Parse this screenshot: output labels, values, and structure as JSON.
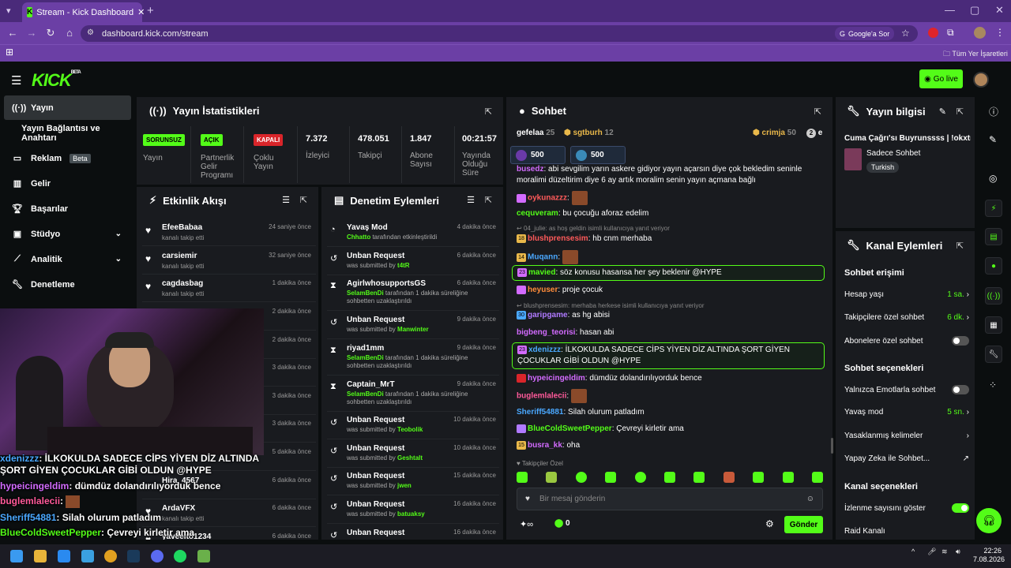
{
  "browser": {
    "tab_title": "Stream - Kick Dashboard",
    "url": "dashboard.kick.com/stream",
    "google_btn": "Google'a Sor",
    "bookmarks_label": "Tüm Yer İşaretleri"
  },
  "header": {
    "logo": "KICK",
    "logo_beta": "BETA",
    "go_live": "Go live"
  },
  "sidebar": {
    "items": [
      {
        "label": "Yayın"
      },
      {
        "label": "Yayın Bağlantısı ve Anahtarı"
      },
      {
        "label": "Reklam",
        "badge": "Beta"
      },
      {
        "label": "Gelir"
      },
      {
        "label": "Başarılar"
      },
      {
        "label": "Stüdyo"
      },
      {
        "label": "Analitik"
      },
      {
        "label": "Denetleme"
      }
    ]
  },
  "stats": {
    "title": "Yayın İstatistikleri",
    "cells": [
      {
        "badge": "SORUNSUZ",
        "label": "Yayın"
      },
      {
        "badge": "AÇIK",
        "label": "Partnerlik Gelir Programı"
      },
      {
        "badge": "KAPALI",
        "label": "Çoklu Yayın"
      },
      {
        "value": "7.372",
        "label": "İzleyici"
      },
      {
        "value": "478.051",
        "label": "Takipçi"
      },
      {
        "value": "1.847",
        "label": "Abone Sayısı"
      },
      {
        "value": "00:21:57",
        "label": "Yayında Olduğu Süre"
      }
    ]
  },
  "feed": {
    "title": "Etkinlik Akışı",
    "items": [
      {
        "name": "EfeeBabaa",
        "sub": "kanalı takip etti",
        "time": "24 saniye önce"
      },
      {
        "name": "carsiemir",
        "sub": "kanalı takip etti",
        "time": "32 saniye önce"
      },
      {
        "name": "cagdasbag",
        "sub": "kanalı takip etti",
        "time": "1 dakika önce"
      },
      {
        "time": "2 dakika önce"
      },
      {
        "time": "2 dakika önce"
      },
      {
        "time": "3 dakika önce"
      },
      {
        "time": "3 dakika önce"
      },
      {
        "time": "3 dakika önce"
      },
      {
        "time": "5 dakika önce"
      },
      {
        "name": "Hira_4567",
        "time": "6 dakika önce"
      },
      {
        "name": "ArdaVFX",
        "sub": "kanalı takip etti",
        "time": "6 dakika önce"
      },
      {
        "name": "yaveelto1234",
        "time": "6 dakika önce"
      }
    ]
  },
  "modlog": {
    "title": "Denetim Eylemleri",
    "items": [
      {
        "name": "Yavaş Mod",
        "by": "Chhatto",
        "rest": " tarafından etkinleştirildi",
        "time": "4 dakika önce"
      },
      {
        "name": "Unban Request",
        "pre": "was submitted by ",
        "by": "t4tR",
        "time": "6 dakika önce"
      },
      {
        "name": "AgirlwhosupportsGS",
        "by": "SelamBenDi",
        "rest": " tarafından 1 dakika süreliğine sohbetten uzaklaştırıldı",
        "time": "6 dakika önce"
      },
      {
        "name": "Unban Request",
        "pre": "was submitted by ",
        "by": "Manwinter",
        "time": "9 dakika önce"
      },
      {
        "name": "riyad1mm",
        "by": "SelamBenDi",
        "rest": " tarafından 1 dakika süreliğine sohbetten uzaklaştırıldı",
        "time": "9 dakika önce"
      },
      {
        "name": "Captain_MrT",
        "by": "SelamBenDi",
        "rest": " tarafından 1 dakika süreliğine sohbetten uzaklaştırıldı",
        "time": "9 dakika önce"
      },
      {
        "name": "Unban Request",
        "pre": "was submitted by ",
        "by": "Teobolik",
        "time": "10 dakika önce"
      },
      {
        "name": "Unban Request",
        "pre": "was submitted by ",
        "by": "Geshtalt",
        "time": "10 dakika önce"
      },
      {
        "name": "Unban Request",
        "pre": "was submitted by ",
        "by": "jwen",
        "time": "15 dakika önce"
      },
      {
        "name": "Unban Request",
        "pre": "was submitted by ",
        "by": "batuaksy",
        "time": "16 dakika önce"
      },
      {
        "name": "Unban Request",
        "time": "16 dakika önce"
      }
    ]
  },
  "chat": {
    "title": "Sohbet",
    "gifters": [
      {
        "name": "gefelaa",
        "count": "25"
      },
      {
        "name": "sgtburh",
        "count": "12"
      },
      {
        "name": "crimja",
        "count": "50"
      },
      {
        "name": "e",
        "count": "2"
      }
    ],
    "pinned": [
      "500",
      "500"
    ],
    "lines": [
      {
        "user": "busedz",
        "color": "#d36bff",
        "text": ": abi sevgilim yarın askere gidiyor yayın açarsın diye çok bekledim seninle moralimi düzeltirim diye 6 ay artık moralim senin yayın açmana bağlı"
      },
      {
        "user": "oykunazzz",
        "color": "#ff5a5a",
        "text": ":"
      },
      {
        "user": "cequveram",
        "color": "#53fc18",
        "text": ": bu çocuğu aforaz edelim"
      },
      {
        "reply": "04_julie: as hoş geldin isimli kullanıcıya yanıt veriyor"
      },
      {
        "user": "blushprensesim",
        "color": "#ff5a5a",
        "text": ": hb cnm merhaba",
        "badge": "18"
      },
      {
        "user": "Muqann",
        "color": "#4aa8ff",
        "text": ":",
        "badge": "14"
      },
      {
        "user": "mavied",
        "color": "#53fc18",
        "text": ": söz konusu hasansa her şey beklenir @HYPE",
        "badge": "23"
      },
      {
        "user": "heyuser",
        "color": "#ff8c3a",
        "text": ": proje çocuk"
      },
      {
        "reply": "blushprensesim: merhaba herkese  isimli kullanıcıya yanıt veriyor"
      },
      {
        "user": "garipgame",
        "color": "#b07aff",
        "text": ": as hg abisi",
        "badge": "30"
      },
      {
        "user": "bigbeng_teorisi",
        "color": "#d36bff",
        "text": ": hasan abi"
      },
      {
        "user": "xdenizzz",
        "color": "#4aa8ff",
        "text": ": İLKOKULDA SADECE CİPS YİYEN DİZ ALTINDA ŞORT GİYEN ÇOCUKLAR GİBİ OLDUN @HYPE",
        "badge": "23"
      },
      {
        "user": "hypeicingeldim",
        "color": "#d36bff",
        "text": ": dümdüz dolandırılıyorduk bence"
      },
      {
        "user": "buglemlalecii",
        "color": "#ff5a9a",
        "text": ":"
      },
      {
        "user": "Sheriff54881",
        "color": "#4aa8ff",
        "text": ": Silah olurum patladım"
      },
      {
        "user": "BlueColdSweetPepper",
        "color": "#53fc18",
        "text": ": Çevreyi kirletir ama"
      },
      {
        "user": "busra_kk",
        "color": "#d36bff",
        "text": ": oha",
        "badge": "15"
      }
    ],
    "followers_label": "Takipçiler Özel",
    "placeholder": "Bir mesaj gönderin",
    "infinity": "∞",
    "points": "0",
    "send": "Gönder"
  },
  "info": {
    "title": "Yayın bilgisi",
    "stream_title": "Cuma Çağrı'sı Buyrunssss | !okxtr",
    "category": "Sadece Sohbet",
    "language": "Turkish"
  },
  "actions": {
    "title": "Kanal Eylemleri",
    "sec1": "Sohbet erişimi",
    "hesap": "Hesap yaşı",
    "hesap_val": "1 sa.",
    "takipci": "Takipçilere özel sohbet",
    "takipci_val": "6 dk.",
    "abone": "Abonelere özel sohbet",
    "sec2": "Sohbet seçenekleri",
    "emote": "Yalnızca Emotlarla sohbet",
    "yavas": "Yavaş mod",
    "yavas_val": "5 sn.",
    "yasak": "Yasaklanmış kelimeler",
    "yz": "Yapay Zeka ile Sohbet...",
    "sec3": "Kanal seçenekleri",
    "izlenme": "İzlenme sayısını göster",
    "raid": "Raid Kanalı"
  },
  "overlay": [
    {
      "user": "xdenizzz",
      "color": "#4aa8ff",
      "text": ": İLKOKULDA SADECE CİPS YİYEN DİZ ALTINDA ŞORT GİYEN ÇOCUKLAR GİBİ OLDUN @HYPE"
    },
    {
      "user": "hypeicingeldim",
      "color": "#d36bff",
      "text": ": dümdüz dolandırılıyorduk bence"
    },
    {
      "user": "buglemlalecii",
      "color": "#ff5a9a",
      "text": ":"
    },
    {
      "user": "Sheriff54881",
      "color": "#4aa8ff",
      "text": ": Silah olurum patladım"
    },
    {
      "user": "BlueColdSweetPepper",
      "color": "#53fc18",
      "text": ": Çevreyi kirletir ama"
    }
  ],
  "taskbar": {
    "time": "22:26",
    "date": "7.08.2026"
  }
}
